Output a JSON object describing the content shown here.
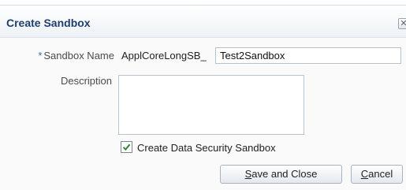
{
  "dialog": {
    "title": "Create Sandbox",
    "close_icon": "close-icon"
  },
  "form": {
    "sandbox_name": {
      "required_marker": "*",
      "label": "Sandbox Name",
      "prefix": "ApplCoreLongSB_",
      "value": "Test2Sandbox"
    },
    "description": {
      "label": "Description",
      "value": ""
    },
    "data_security": {
      "label": "Create Data Security Sandbox",
      "checked": true
    }
  },
  "buttons": {
    "save": {
      "accel": "S",
      "rest": "ave and Close"
    },
    "cancel": {
      "accel": "C",
      "rest": "ancel"
    }
  }
}
